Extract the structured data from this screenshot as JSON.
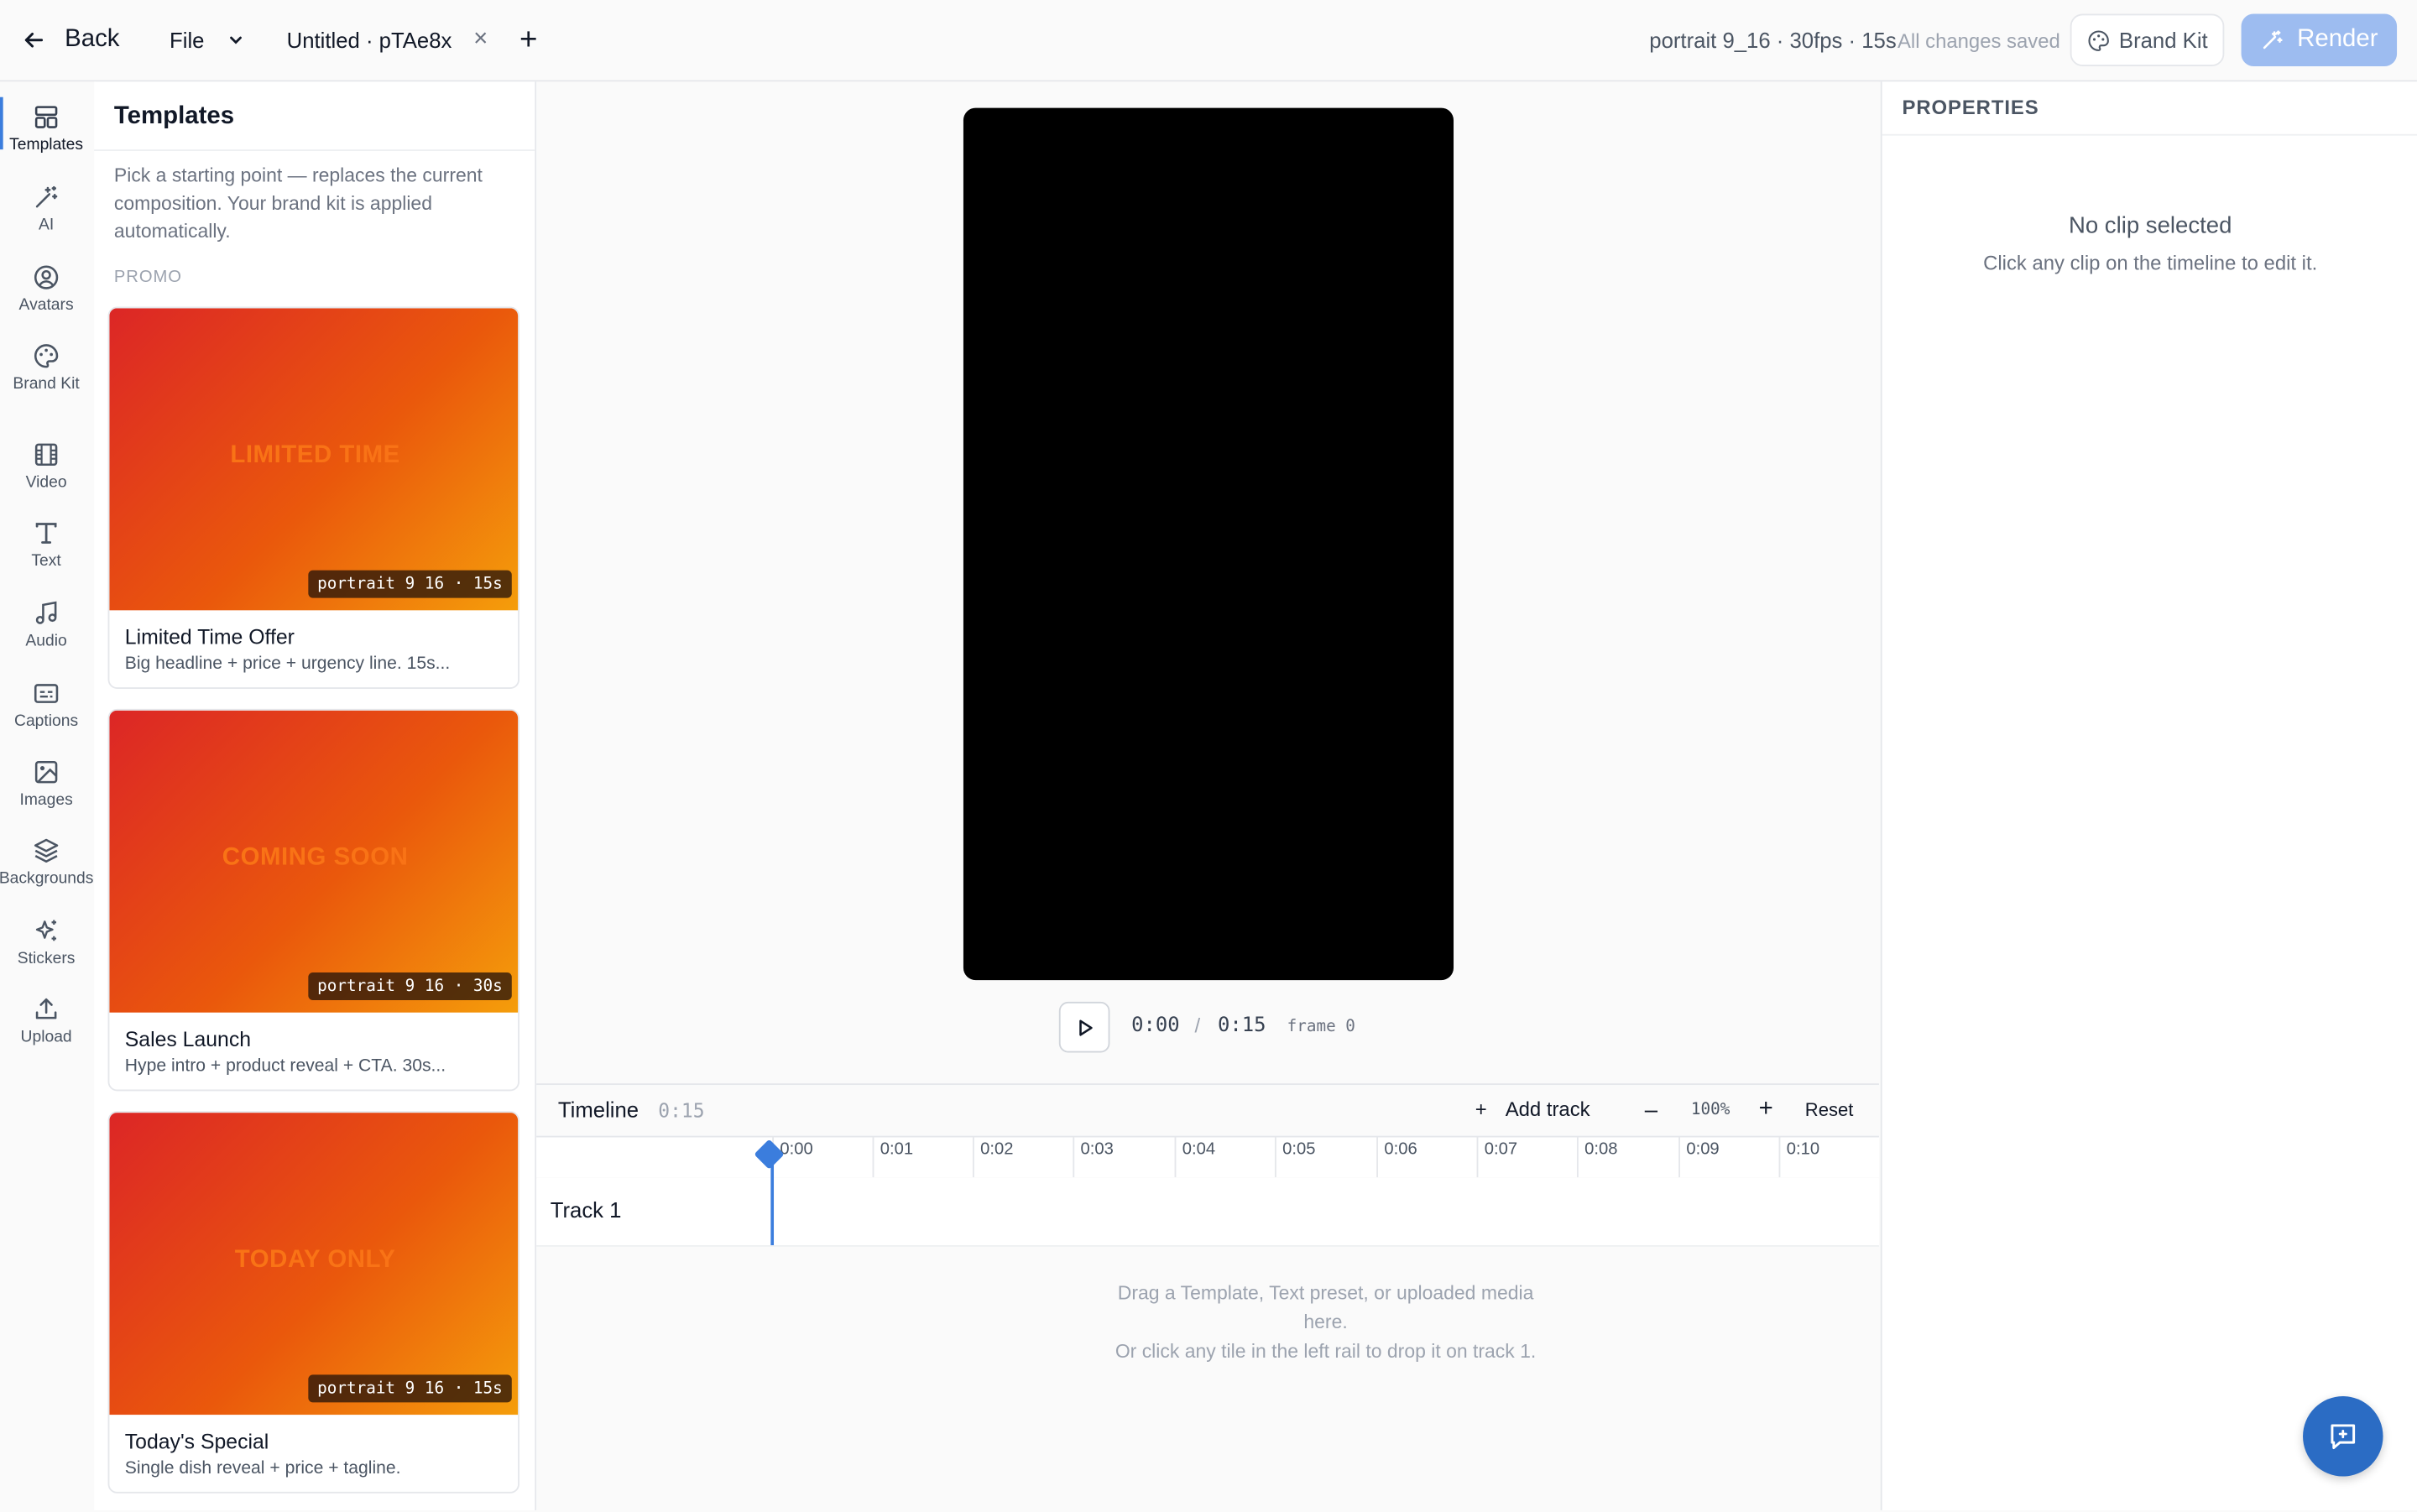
{
  "topbar": {
    "back_label": "Back",
    "file_label": "File",
    "tab_title": "Untitled · pTAe8x",
    "meta": "portrait 9_16 · 30fps · 15s",
    "saved_status": "All changes saved",
    "brand_kit_label": "Brand Kit",
    "render_label": "Render"
  },
  "rail": {
    "items": [
      {
        "label": "Templates",
        "icon": "templates-icon"
      },
      {
        "label": "AI",
        "icon": "magic-wand-icon"
      },
      {
        "label": "Avatars",
        "icon": "avatar-icon"
      },
      {
        "label": "Brand Kit",
        "icon": "palette-icon"
      },
      {
        "label": "Video",
        "icon": "film-icon"
      },
      {
        "label": "Text",
        "icon": "text-icon"
      },
      {
        "label": "Audio",
        "icon": "music-icon"
      },
      {
        "label": "Captions",
        "icon": "captions-icon"
      },
      {
        "label": "Images",
        "icon": "image-icon"
      },
      {
        "label": "Backgrounds",
        "icon": "layers-icon"
      },
      {
        "label": "Stickers",
        "icon": "sparkles-icon"
      },
      {
        "label": "Upload",
        "icon": "upload-icon"
      }
    ]
  },
  "templates": {
    "title": "Templates",
    "description": "Pick a starting point — replaces the current composition. Your brand kit is applied automatically.",
    "section": "PROMO",
    "cards": [
      {
        "thumb_text": "LIMITED TIME",
        "badge": "portrait 9 16 · 15s",
        "name": "Limited Time Offer",
        "desc": "Big headline + price + urgency line. 15s..."
      },
      {
        "thumb_text": "COMING SOON",
        "badge": "portrait 9 16 · 30s",
        "name": "Sales Launch",
        "desc": "Hype intro + product reveal + CTA. 30s..."
      },
      {
        "thumb_text": "TODAY ONLY",
        "badge": "portrait 9 16 · 15s",
        "name": "Today's Special",
        "desc": "Single dish reveal + price + tagline."
      }
    ]
  },
  "player": {
    "current_time": "0:00",
    "separator": "/",
    "duration": "0:15",
    "frame": "frame 0"
  },
  "timeline": {
    "title": "Timeline",
    "duration": "0:15",
    "add_track_label": "Add track",
    "minus": "–",
    "zoom": "100%",
    "plus": "+",
    "reset_label": "Reset",
    "ticks": [
      "0:00",
      "0:01",
      "0:02",
      "0:03",
      "0:04",
      "0:05",
      "0:06",
      "0:07",
      "0:08",
      "0:09",
      "0:10"
    ],
    "track_name": "Track 1",
    "hint_line1": "Drag a Template, Text preset, or uploaded media here.",
    "hint_line2": "Or click any tile in the left rail to drop it on track 1."
  },
  "properties": {
    "title": "PROPERTIES",
    "empty_title": "No clip selected",
    "empty_desc": "Click any clip on the timeline to edit it."
  },
  "colors": {
    "accent": "#3b7ddd",
    "render_button": "#9dbcf0",
    "chat_fab": "#2b6cc4",
    "thumb_gradient_start": "#dc2626",
    "thumb_gradient_end": "#f59e0b"
  }
}
